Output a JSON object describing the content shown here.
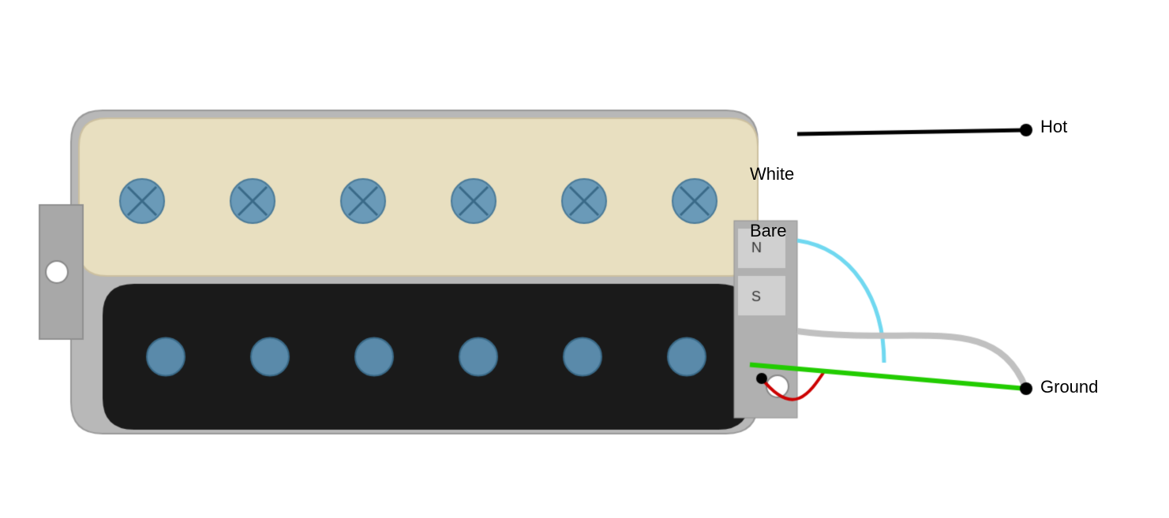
{
  "labels": {
    "hot": "Hot",
    "white": "White",
    "bare": "Bare",
    "ground": "Ground"
  },
  "colors": {
    "background": "#ffffff",
    "cream_body": "#e8dfc0",
    "black_body": "#1a1a1a",
    "metal_base": "#b0b0b0",
    "screw_blue": "#5a8aaa",
    "wire_black": "#000000",
    "wire_cyan": "#70d8f0",
    "wire_gray": "#c0c0c0",
    "wire_red": "#cc0000",
    "wire_green": "#22cc00",
    "connector_dot": "#000000"
  }
}
